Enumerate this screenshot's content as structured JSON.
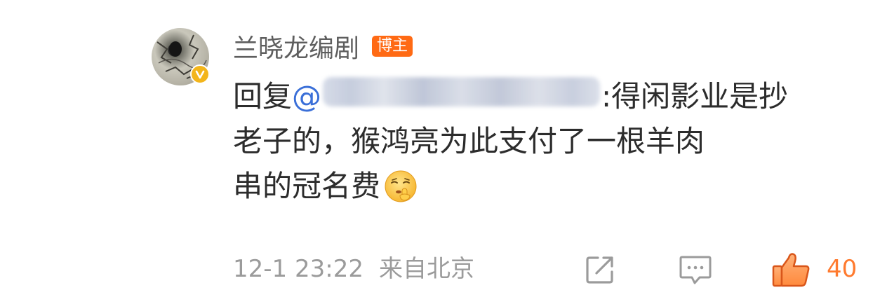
{
  "comment": {
    "author": {
      "name": "兰晓龙编剧",
      "badge": "博主",
      "verified_color": "#f3b51b"
    },
    "body": {
      "line1_prefix": "回复",
      "mention": "@",
      "line1_suffix": ":得闲影业是抄",
      "line2": "老子的，猴鸿亮为此支付了一根羊肉",
      "line3": "串的冠名费",
      "emoji": "shushing-face"
    },
    "meta": {
      "time": "12-1 23:22",
      "source": "来自北京"
    },
    "actions": {
      "share_icon": "share-icon",
      "comment_icon": "comment-icon",
      "like_icon": "thumbs-up-icon",
      "like_count": "40"
    },
    "colors": {
      "mention": "#3a6fd8",
      "badge": "#ff6a14",
      "like": "#ff7a2e",
      "meta": "#9b9b9b"
    }
  }
}
